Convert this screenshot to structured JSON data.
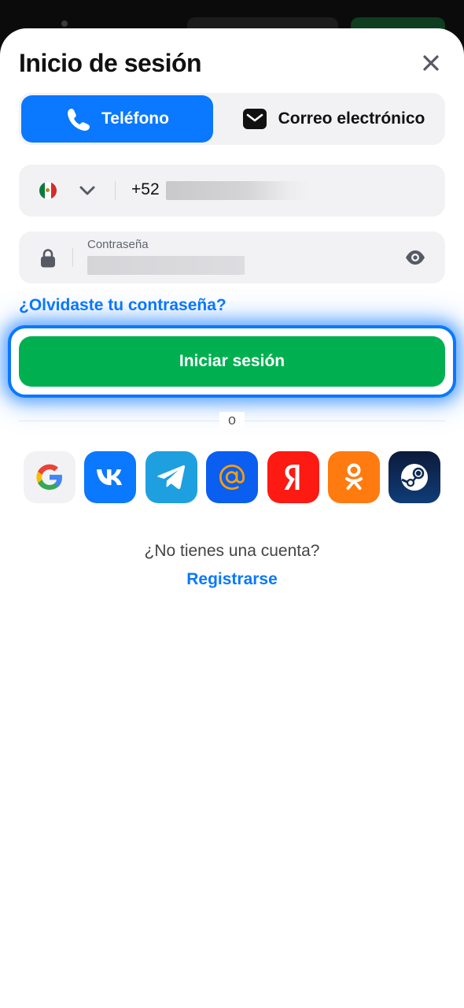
{
  "dialog": {
    "title": "Inicio de sesión"
  },
  "tabs": [
    {
      "label": "Teléfono",
      "icon": "phone-icon",
      "active": true
    },
    {
      "label": "Correo electrónico",
      "icon": "envelope-icon",
      "active": false
    }
  ],
  "phone": {
    "country_icon": "mexico-flag-icon",
    "prefix": "+52"
  },
  "password": {
    "label": "Contraseña"
  },
  "forgot_label": "¿Olvidaste tu contraseña?",
  "login_label": "Iniciar sesión",
  "divider_text": "o",
  "socials": [
    {
      "icon": "google-icon",
      "color": "#f2f2f4"
    },
    {
      "icon": "vk-icon",
      "color": "#0a78ff"
    },
    {
      "icon": "telegram-icon",
      "color": "#1ea0e0"
    },
    {
      "icon": "mailru-icon",
      "color": "#0a5ef0"
    },
    {
      "icon": "yandex-icon",
      "color": "#fc1a12"
    },
    {
      "icon": "odnoklassniki-icon",
      "color": "#ff7b0f"
    },
    {
      "icon": "steam-icon",
      "color": "#0d2a52"
    }
  ],
  "footer": {
    "no_account": "¿No tienes una cuenta?",
    "register_label": "Registrarse"
  },
  "colors": {
    "accent": "#0a78ff",
    "login_button": "#00b050"
  }
}
